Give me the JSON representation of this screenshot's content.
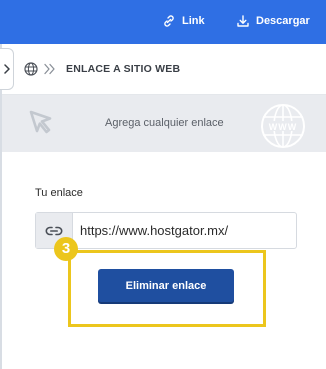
{
  "colors": {
    "topbar": "#2f6fe4",
    "button": "#1f4fa0",
    "highlight": "#ecc61d",
    "hint_strip": "#e9ebef"
  },
  "topbar": {
    "link_label": "Link",
    "link_icon": "link-icon",
    "download_label": "Descargar",
    "download_icon": "download-icon"
  },
  "breadcrumb": {
    "collapse_icon": "chevron-right-icon",
    "section_icon": "globe-icon",
    "separator_icon": "double-chevron-icon",
    "title": "ENLACE A SITIO WEB"
  },
  "hint": {
    "text": "Agrega cualquier enlace",
    "left_icon": "cursor-arrow-icon",
    "right_icon": "www-globe-icon"
  },
  "link_form": {
    "label": "Tu enlace",
    "field_icon": "link-icon",
    "value": "https://www.hostgator.mx/"
  },
  "step_badge": "3",
  "delete_button_label": "Eliminar enlace"
}
